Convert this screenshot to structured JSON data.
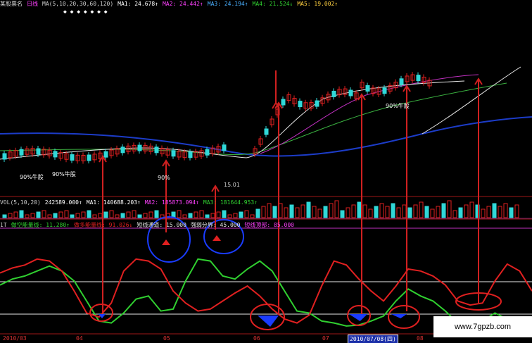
{
  "header": {
    "stock_title": "某股票名",
    "period": "日线",
    "ma_params": "MA(5,10,20,30,60,120)",
    "ma1": "MA1: 24.678↑",
    "ma2": "MA2: 24.442↑",
    "ma3": "MA3: 24.194↑",
    "ma4": "MA4: 21.524↓",
    "ma5": "MA5: 19.002↑",
    "markers": "◆ ◆ ◆ ◆ ◆ ◆ ◆"
  },
  "vol_header": {
    "params": "VOL(5,10,20)",
    "value": "242589.000↑",
    "ma1": "MA1: 140688.203↑",
    "ma2": "MA2: 185873.094↑",
    "ma3": "MA3: 181644.953↑"
  },
  "ind_header": {
    "name": "1T",
    "a": "做空能量线: 11.280↑",
    "b": "做多能量线: 91.026↓",
    "c": "短线通道: 15.000",
    "d": "强弱分界: 45.000",
    "e": "短线顶部: 85.000"
  },
  "annotations": [
    "90%牛股",
    "90%牛股",
    "90%",
    "90%牛股"
  ],
  "price_label": "15.01",
  "dates": [
    {
      "text": "2010/03",
      "selected": false
    },
    {
      "text": "04",
      "selected": false
    },
    {
      "text": "05",
      "selected": false
    },
    {
      "text": "06",
      "selected": false
    },
    {
      "text": "07",
      "selected": false
    },
    {
      "text": "2010/07/08(四)",
      "selected": true
    },
    {
      "text": "08",
      "selected": false
    }
  ],
  "watermark": "www.7gpzb.com",
  "colors": {
    "bg": "#000000",
    "red_line": "#e02020",
    "green_line": "#30d030",
    "blue_fill": "#1a3cff",
    "ma_blue": "#1c3cc8",
    "ma_white": "#e8e8e8",
    "ma_green": "#3ab040",
    "ma_magenta": "#c030c0"
  },
  "chart_data": {
    "type": "line",
    "series": [
      {
        "name": "做空能量线",
        "values": [
          46,
          52,
          55,
          60,
          65,
          60,
          50,
          30,
          10,
          8,
          18,
          32,
          35,
          20,
          22,
          50,
          72,
          70,
          55,
          52,
          62,
          70,
          60,
          40,
          20,
          18,
          10,
          8,
          5,
          6,
          10,
          15,
          30,
          42,
          35,
          30,
          20,
          8,
          6,
          10,
          18,
          12,
          14,
          10
        ]
      },
      {
        "name": "做多能量线",
        "values": [
          58,
          63,
          66,
          72,
          70,
          60,
          40,
          18,
          14,
          28,
          60,
          72,
          70,
          62,
          40,
          28,
          20,
          22,
          30,
          38,
          45,
          35,
          22,
          12,
          8,
          16,
          45,
          70,
          66,
          52,
          40,
          30,
          45,
          62,
          60,
          55,
          46,
          30,
          26,
          28,
          50,
          67,
          60,
          40
        ]
      }
    ]
  }
}
